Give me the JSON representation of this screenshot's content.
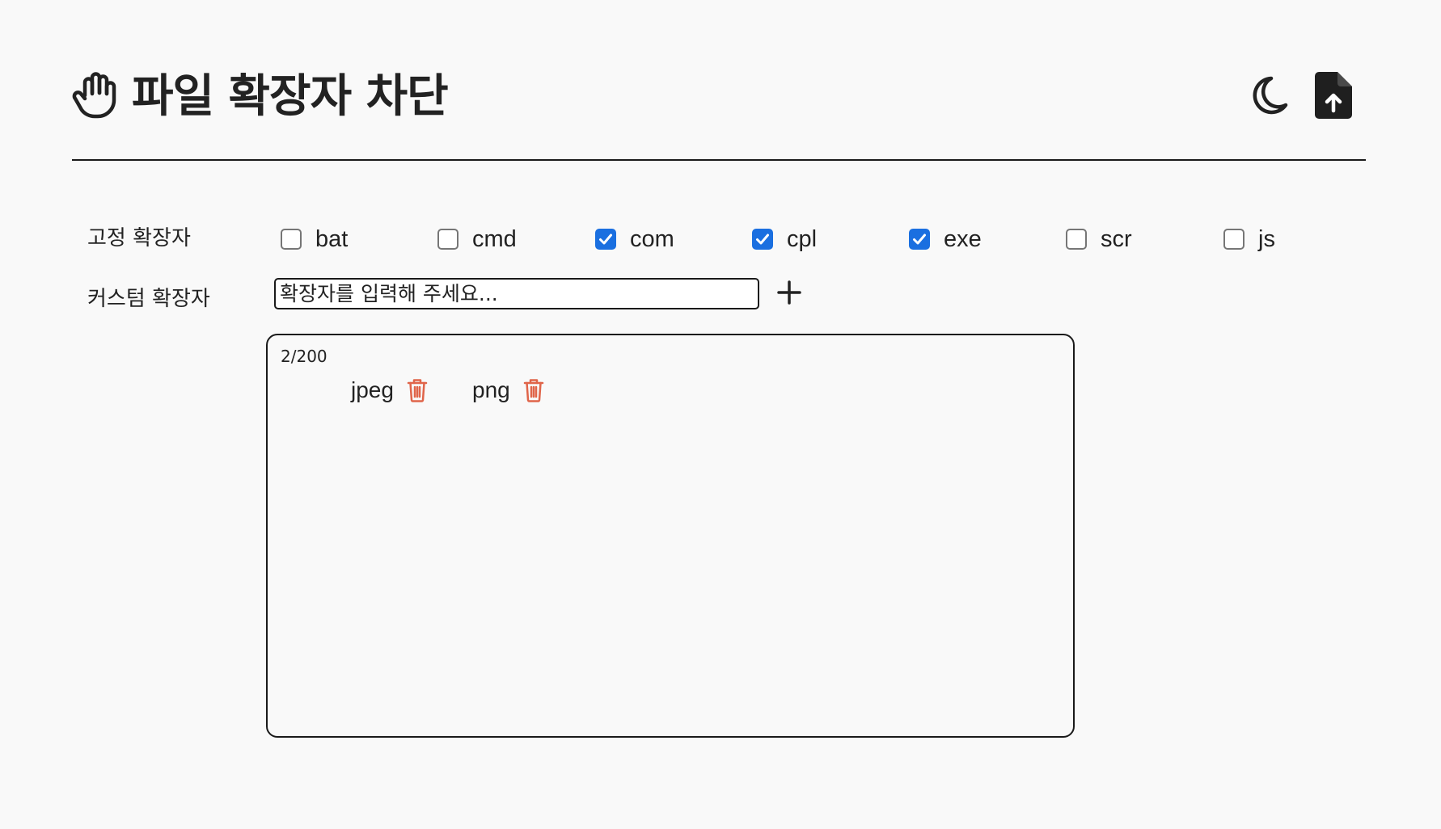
{
  "header": {
    "title": "파일 확장자 차단",
    "icons": [
      "hand-icon",
      "moon-icon",
      "file-upload-icon"
    ]
  },
  "fixed": {
    "label": "고정 확장자",
    "items": [
      {
        "label": "bat",
        "checked": false
      },
      {
        "label": "cmd",
        "checked": false
      },
      {
        "label": "com",
        "checked": true
      },
      {
        "label": "cpl",
        "checked": true
      },
      {
        "label": "exe",
        "checked": true
      },
      {
        "label": "scr",
        "checked": false
      },
      {
        "label": "js",
        "checked": false
      }
    ]
  },
  "custom": {
    "label": "커스텀 확장자",
    "placeholder": "확장자를 입력해 주세요...",
    "add_icon": "plus-icon",
    "count": "2/200",
    "items": [
      {
        "label": "jpeg"
      },
      {
        "label": "png"
      }
    ],
    "delete_icon": "trash-icon"
  },
  "colors": {
    "background": "#f9f9f9",
    "text": "#222222",
    "checkbox_checked": "#1a6fe0",
    "trash": "#e0654a"
  }
}
